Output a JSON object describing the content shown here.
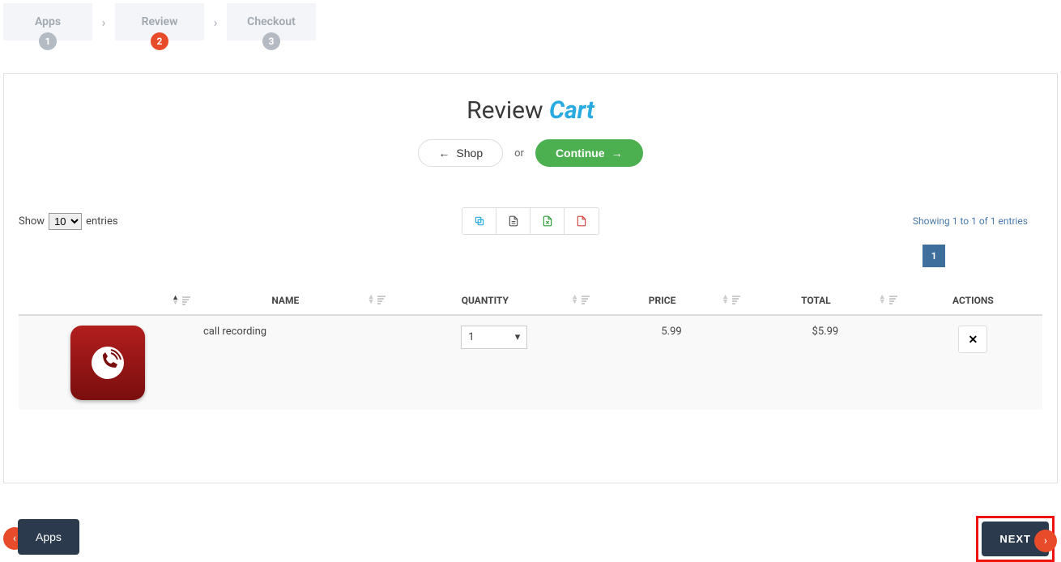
{
  "steps": [
    {
      "label": "Apps",
      "num": "1",
      "active": false
    },
    {
      "label": "Review",
      "num": "2",
      "active": true
    },
    {
      "label": "Checkout",
      "num": "3",
      "active": false
    }
  ],
  "title": {
    "text": "Review",
    "accent": "Cart"
  },
  "buttons": {
    "shop": "Shop",
    "or": "or",
    "continue": "Continue"
  },
  "entries": {
    "show": "Show",
    "suffix": "entries",
    "value": "10"
  },
  "showing": "Showing 1 to 1 of 1 entries",
  "page": "1",
  "columns": {
    "name": "NAME",
    "quantity": "QUANTITY",
    "price": "PRICE",
    "total": "TOTAL",
    "actions": "ACTIONS"
  },
  "row": {
    "name": "call recording",
    "quantity": "1",
    "price": "5.99",
    "total": "$5.99"
  },
  "nav": {
    "prev": "Apps",
    "next": "NEXT"
  },
  "icons": {
    "copy": "copy-icon",
    "text": "file-text-icon",
    "excel": "file-excel-icon",
    "pdf": "file-pdf-icon"
  }
}
